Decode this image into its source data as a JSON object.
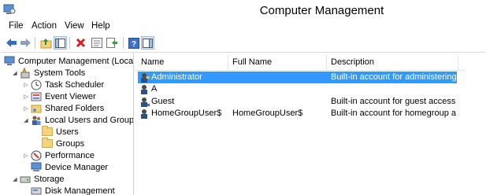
{
  "window": {
    "title": "Computer Management",
    "app_icon": "computer-management-icon"
  },
  "menu": [
    "File",
    "Action",
    "View",
    "Help"
  ],
  "toolbar": {
    "buttons": [
      "back-icon",
      "forward-icon",
      "up-folder-icon",
      "show-tree-icon",
      "delete-icon",
      "properties-icon",
      "export-icon",
      "help-icon",
      "show-action-pane-icon"
    ]
  },
  "tree": {
    "items": [
      {
        "label": "Computer Management (Local)",
        "icon": "computer-icon",
        "level": 0,
        "expander": ""
      },
      {
        "label": "System Tools",
        "icon": "tools-icon",
        "level": 1,
        "expander": "expanded"
      },
      {
        "label": "Task Scheduler",
        "icon": "clock-icon",
        "level": 2,
        "expander": "collapsed"
      },
      {
        "label": "Event Viewer",
        "icon": "event-viewer-icon",
        "level": 2,
        "expander": "collapsed"
      },
      {
        "label": "Shared Folders",
        "icon": "shared-folder-icon",
        "level": 2,
        "expander": "collapsed"
      },
      {
        "label": "Local Users and Groups",
        "icon": "users-groups-icon",
        "level": 2,
        "expander": "expanded"
      },
      {
        "label": "Users",
        "icon": "folder-icon",
        "level": 3,
        "expander": ""
      },
      {
        "label": "Groups",
        "icon": "folder-icon",
        "level": 3,
        "expander": ""
      },
      {
        "label": "Performance",
        "icon": "performance-icon",
        "level": 2,
        "expander": "collapsed"
      },
      {
        "label": "Device Manager",
        "icon": "device-manager-icon",
        "level": 2,
        "expander": ""
      },
      {
        "label": "Storage",
        "icon": "storage-icon",
        "level": 1,
        "expander": "expanded"
      },
      {
        "label": "Disk Management",
        "icon": "disk-icon",
        "level": 2,
        "expander": ""
      }
    ]
  },
  "list": {
    "columns": [
      "Name",
      "Full Name",
      "Description"
    ],
    "rows": [
      {
        "name": "Administrator",
        "full_name": "",
        "description": "Built-in account for administering...",
        "selected": true
      },
      {
        "name": "A",
        "full_name": "",
        "description": "",
        "selected": false
      },
      {
        "name": "Guest",
        "full_name": "",
        "description": "Built-in account for guest access t...",
        "selected": false
      },
      {
        "name": "HomeGroupUser$",
        "full_name": "HomeGroupUser$",
        "description": "Built-in account for homegroup a...",
        "selected": false
      }
    ]
  },
  "colors": {
    "selection": "#3399ff",
    "folder": "#f3d37b"
  }
}
